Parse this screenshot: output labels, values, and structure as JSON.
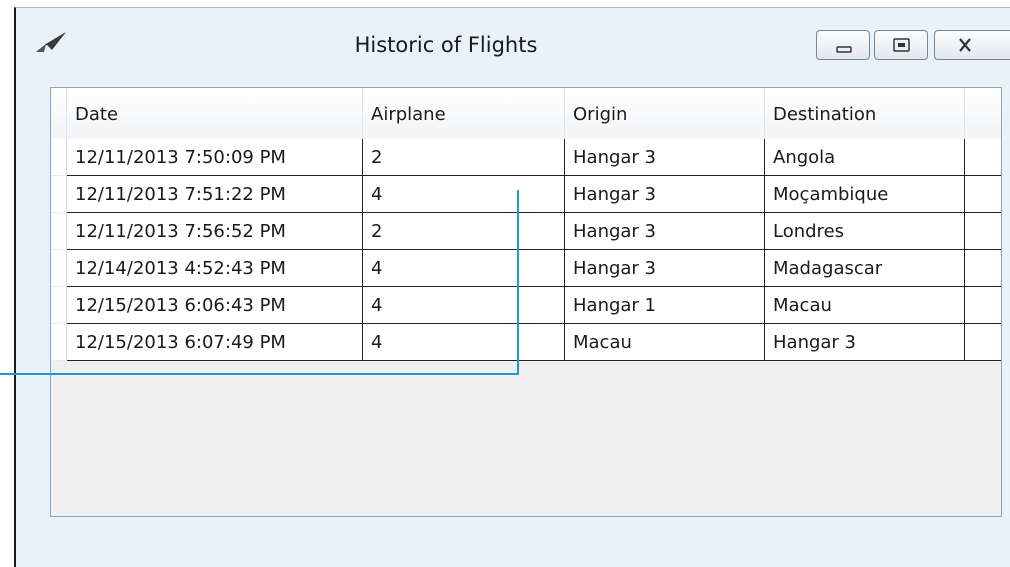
{
  "window": {
    "title": "Historic of Flights"
  },
  "colors": {
    "accent_line": "#1e9bd7",
    "grid_border": "#8aa4c0"
  },
  "table": {
    "columns": [
      "Date",
      "Airplane",
      "Origin",
      "Destination"
    ],
    "rows": [
      {
        "date": "12/11/2013 7:50:09 PM",
        "airplane": "2",
        "origin": "Hangar 3",
        "destination": "Angola"
      },
      {
        "date": "12/11/2013 7:51:22 PM",
        "airplane": "4",
        "origin": "Hangar 3",
        "destination": "Moçambique"
      },
      {
        "date": "12/11/2013 7:56:52 PM",
        "airplane": "2",
        "origin": "Hangar 3",
        "destination": "Londres"
      },
      {
        "date": "12/14/2013 4:52:43 PM",
        "airplane": "4",
        "origin": "Hangar 3",
        "destination": "Madagascar"
      },
      {
        "date": "12/15/2013 6:06:43 PM",
        "airplane": "4",
        "origin": "Hangar 1",
        "destination": "Macau"
      },
      {
        "date": "12/15/2013 6:07:49 PM",
        "airplane": "4",
        "origin": "Macau",
        "destination": "Hangar 3"
      }
    ]
  },
  "icons": {
    "app": "paper-plane-icon",
    "minimize": "minimize-icon",
    "maximize": "maximize-icon",
    "close": "close-icon"
  }
}
